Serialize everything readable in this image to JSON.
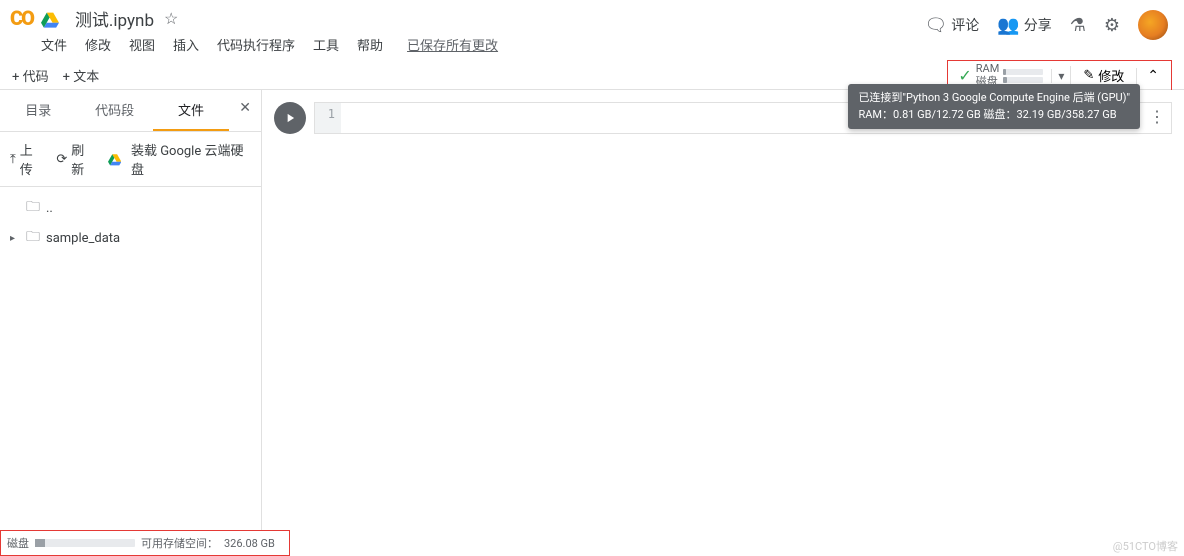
{
  "header": {
    "logo_text": "CO",
    "title": "测试.ipynb",
    "autosave": "已保存所有更改",
    "comment": "评论",
    "share": "分享"
  },
  "menu": [
    "文件",
    "修改",
    "视图",
    "插入",
    "代码执行程序",
    "工具",
    "帮助"
  ],
  "toolbar": {
    "add_code": "+ 代码",
    "add_text": "+ 文本",
    "edit": "修改"
  },
  "resource": {
    "ram_label": "RAM",
    "disk_label": "磁盘",
    "tooltip_line1": "已连接到\"Python 3 Google Compute Engine 后端 (GPU)\"",
    "tooltip_line2": "RAM：0.81 GB/12.72 GB 磁盘：32.19 GB/358.27 GB"
  },
  "sidebar": {
    "tabs": {
      "toc": "目录",
      "snippets": "代码段",
      "files": "文件"
    },
    "actions": {
      "upload": "上传",
      "refresh": "刷新",
      "mount": "装载 Google 云端硬盘"
    },
    "items": [
      {
        "name": "..",
        "icon": "folder"
      },
      {
        "name": "sample_data",
        "icon": "folder"
      }
    ]
  },
  "disk_footer": {
    "label": "磁盘",
    "avail_label": "可用存储空间：",
    "avail_value": "326.08 GB"
  },
  "cell": {
    "line_number": "1",
    "content": ""
  },
  "watermark": "@51CTO博客"
}
